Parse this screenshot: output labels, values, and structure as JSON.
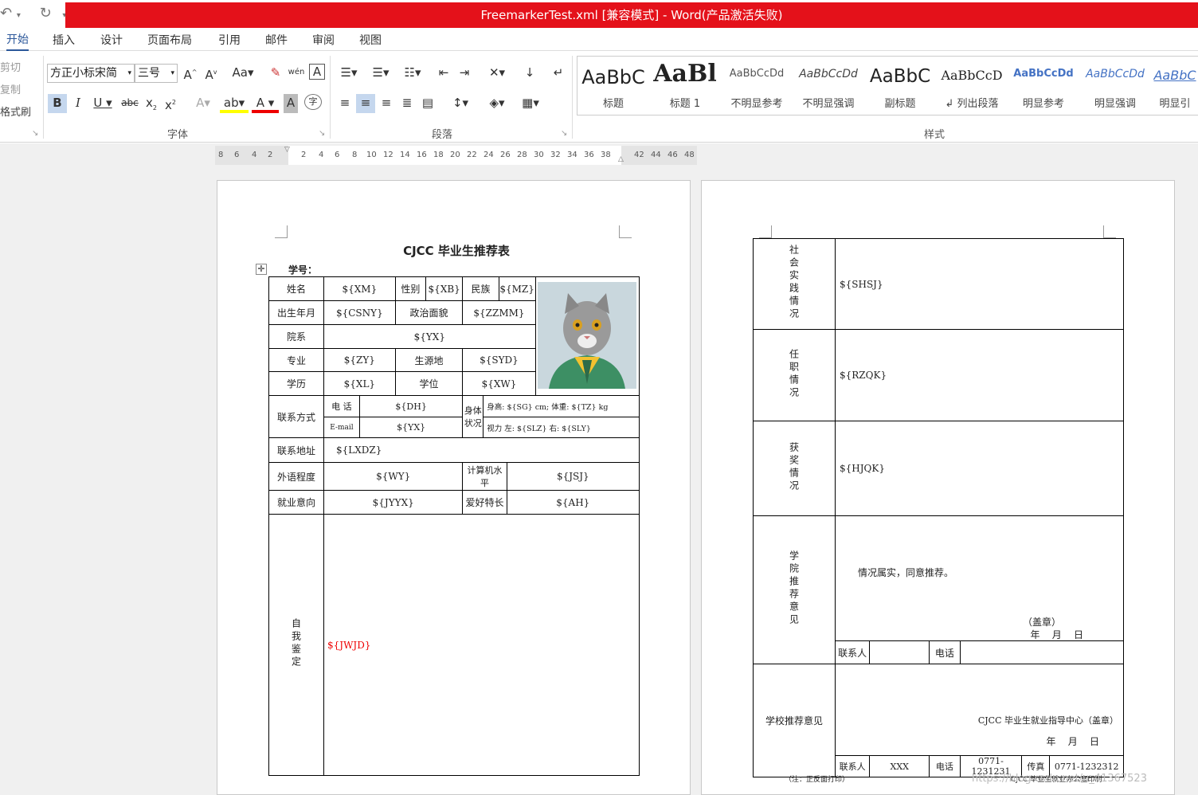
{
  "window": {
    "title": "FreemarkerTest.xml [兼容模式] - Word(产品激活失败)"
  },
  "tabs": [
    "开始",
    "插入",
    "设计",
    "页面布局",
    "引用",
    "邮件",
    "审阅",
    "视图"
  ],
  "clipboard": {
    "cut": "剪切",
    "copy": "复制",
    "format_painter": "格式刷"
  },
  "font": {
    "name": "方正小标宋简",
    "size": "三号",
    "group": "字体"
  },
  "paragraph": {
    "group": "段落"
  },
  "styles": {
    "group": "样式",
    "items": [
      {
        "preview": "AaBbC",
        "name": "标题"
      },
      {
        "preview": "AaBl",
        "name": "标题 1"
      },
      {
        "preview": "AaBbCcDd",
        "name": "不明显参考"
      },
      {
        "preview": "AaBbCcDd",
        "name": "不明显强调"
      },
      {
        "preview": "AaBbC",
        "name": "副标题"
      },
      {
        "preview": "AaBbCcD",
        "name": "↲ 列出段落"
      },
      {
        "preview": "AaBbCcDd",
        "name": "明显参考"
      },
      {
        "preview": "AaBbCcDd",
        "name": "明显强调"
      },
      {
        "preview": "AaBbC",
        "name": "明显引"
      }
    ]
  },
  "ruler": [
    "8",
    "6",
    "4",
    "2",
    "2",
    "4",
    "6",
    "8",
    "10",
    "12",
    "14",
    "16",
    "18",
    "20",
    "22",
    "24",
    "26",
    "28",
    "30",
    "32",
    "34",
    "36",
    "38",
    "42",
    "44",
    "46",
    "48"
  ],
  "doc": {
    "title": "CJCC 毕业生推荐表",
    "xuehao": "学号：",
    "r1": [
      "姓名",
      "${XM}",
      "性别",
      "${XB}",
      "民族",
      "${MZ}"
    ],
    "r2": [
      "出生年月",
      "${CSNY}",
      "政治面貌",
      "${ZZMM}"
    ],
    "r3": [
      "院系",
      "${YX}"
    ],
    "r4": [
      "专业",
      "${ZY}",
      "生源地",
      "${SYD}"
    ],
    "r5": [
      "学历",
      "${XL}",
      "学位",
      "${XW}"
    ],
    "contact": {
      "label": "联系方式",
      "phone": "电  话",
      "phone_v": "${DH}",
      "email": "E-mail",
      "email_v": "${YX}",
      "body": "身体状况",
      "hw": "身高: ${SG} cm; 体重: ${TZ} kg",
      "vision": "视力  左: ${SLZ} 右: ${SLY}"
    },
    "addr": [
      "联系地址",
      "${LXDZ}"
    ],
    "lang": [
      "外语程度",
      "${WY}",
      "计算机水平",
      "${JSJ}"
    ],
    "job": [
      "就业意向",
      "${JYYX}",
      "爱好特长",
      "${AH}"
    ],
    "self": [
      "自我鉴定",
      "${JWJD}"
    ]
  },
  "doc2": {
    "shsj": [
      "社会实践情况",
      "${SHSJ}"
    ],
    "rzqk": [
      "任职情况",
      "${RZQK}"
    ],
    "hjqk": [
      "获奖情况",
      "${HJQK}"
    ],
    "xytj": {
      "label": "学院推荐意见",
      "text": "情况属实，同意推荐。",
      "seal": "（盖章）",
      "date": "年    月    日",
      "contact": "联系人",
      "phone": "电话"
    },
    "xxtj": {
      "label": "学校推荐意见",
      "text": "CJCC 毕业生就业指导中心（盖章）",
      "date": "年    月    日",
      "contact": "联系人",
      "contact_v": "XXX",
      "phone": "电话",
      "phone_v": "0771-1231231",
      "fax": "传真",
      "fax_v": "0771-1232312"
    },
    "note": "（注：正反面打印）",
    "footer": "CJCC 毕业生就业办公室印制"
  },
  "watermark": "https://blog.csdn.net/u_41367523"
}
